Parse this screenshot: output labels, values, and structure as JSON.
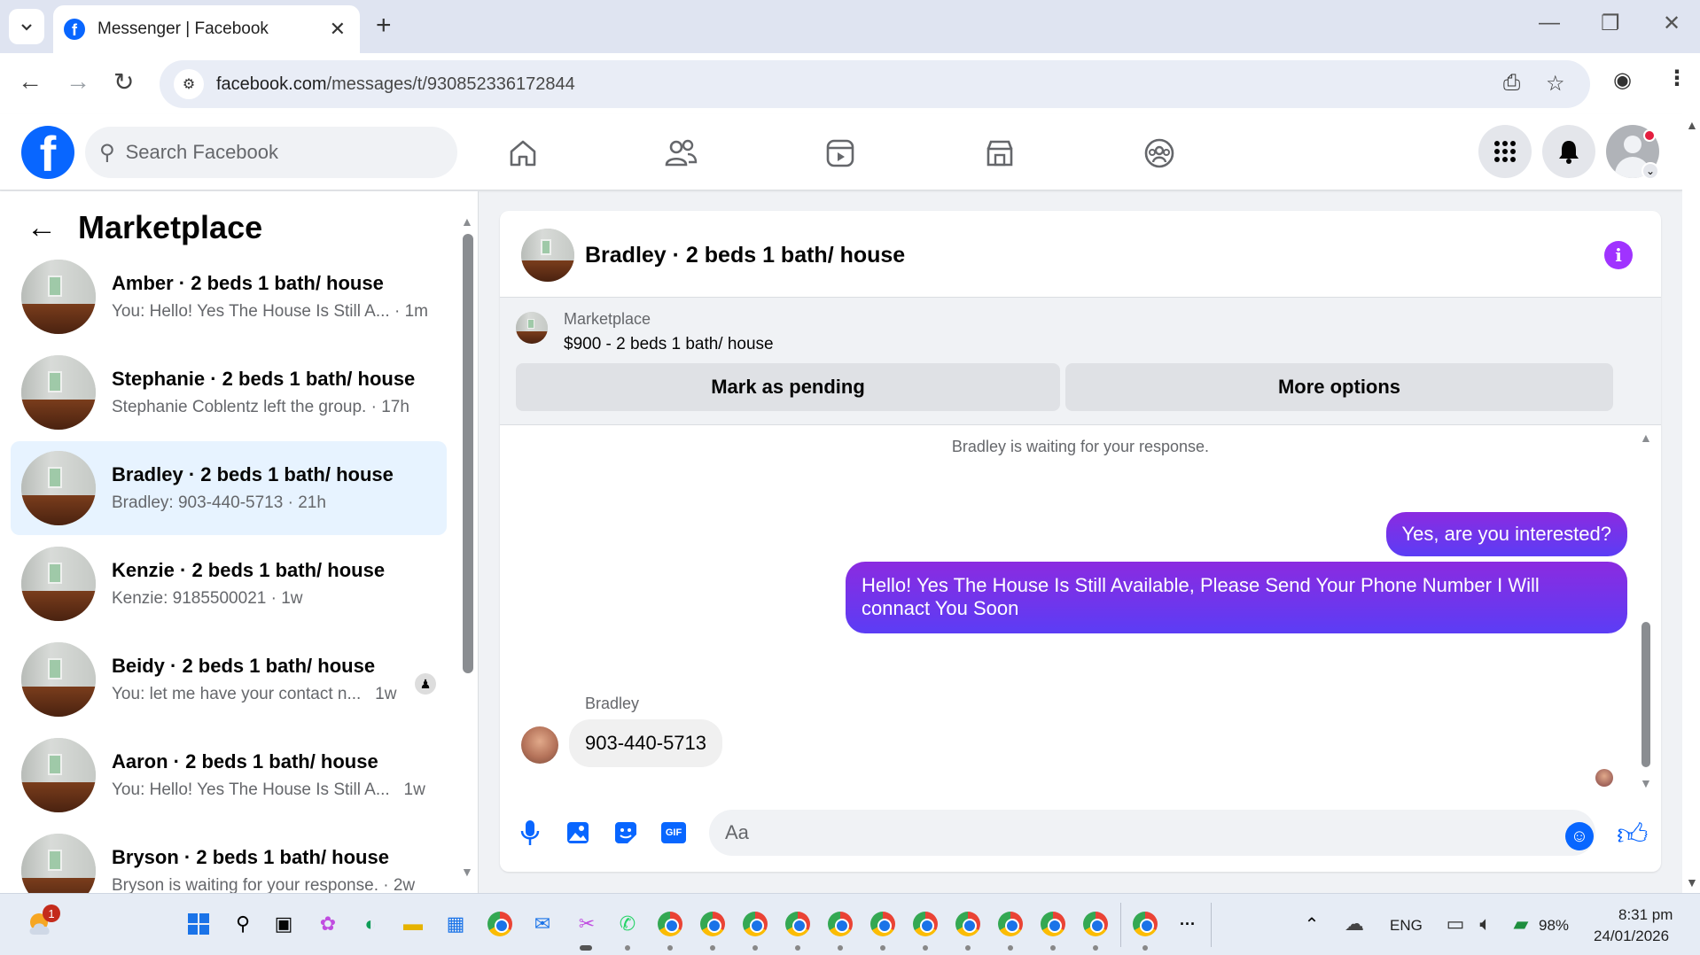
{
  "browser": {
    "tab_title": "Messenger | Facebook",
    "url_host": "facebook.com",
    "url_path": "/messages/t/930852336172844"
  },
  "header": {
    "search_placeholder": "Search Facebook"
  },
  "sidebar": {
    "title": "Marketplace",
    "conversations": [
      {
        "name": "Amber · 2 beds 1 bath/ house",
        "preview": "You: Hello! Yes The House Is Still A...",
        "time": "1m"
      },
      {
        "name": "Stephanie · 2 beds 1 bath/ house",
        "preview": "Stephanie Coblentz left the group.",
        "time": "17h"
      },
      {
        "name": "Bradley · 2 beds 1 bath/ house",
        "preview": "Bradley: 903-440-5713",
        "time": "21h"
      },
      {
        "name": "Kenzie · 2 beds 1 bath/ house",
        "preview": "Kenzie: 9185500021",
        "time": "1w"
      },
      {
        "name": "Beidy · 2 beds 1 bath/ house",
        "preview": "You: let me have your contact n...",
        "time": "1w"
      },
      {
        "name": "Aaron · 2 beds 1 bath/ house",
        "preview": "You: Hello! Yes The House Is Still A...",
        "time": "1w"
      },
      {
        "name": "Bryson · 2 beds 1 bath/ house",
        "preview": "Bryson is waiting for your response.",
        "time": "2w"
      }
    ]
  },
  "chat": {
    "title": "Bradley · 2 beds 1 bath/ house",
    "marketplace_label": "Marketplace",
    "listing": "$900 - 2 beds 1 bath/ house",
    "mark_pending": "Mark as pending",
    "more_options": "More options",
    "waiting_note": "Bradley is waiting for your response.",
    "msg_out_1": "Yes, are you interested?",
    "msg_out_2": "Hello! Yes The House  Is Still Available, Please Send Your Phone Number I Will connact You Soon",
    "sender_name": "Bradley",
    "msg_in_1": "903-440-5713",
    "input_placeholder": "Aa"
  },
  "taskbar": {
    "weather_badge": "1",
    "lang": "ENG",
    "battery": "98%",
    "time": "8:31 pm",
    "date": "24/01/2026",
    "more": "···"
  }
}
